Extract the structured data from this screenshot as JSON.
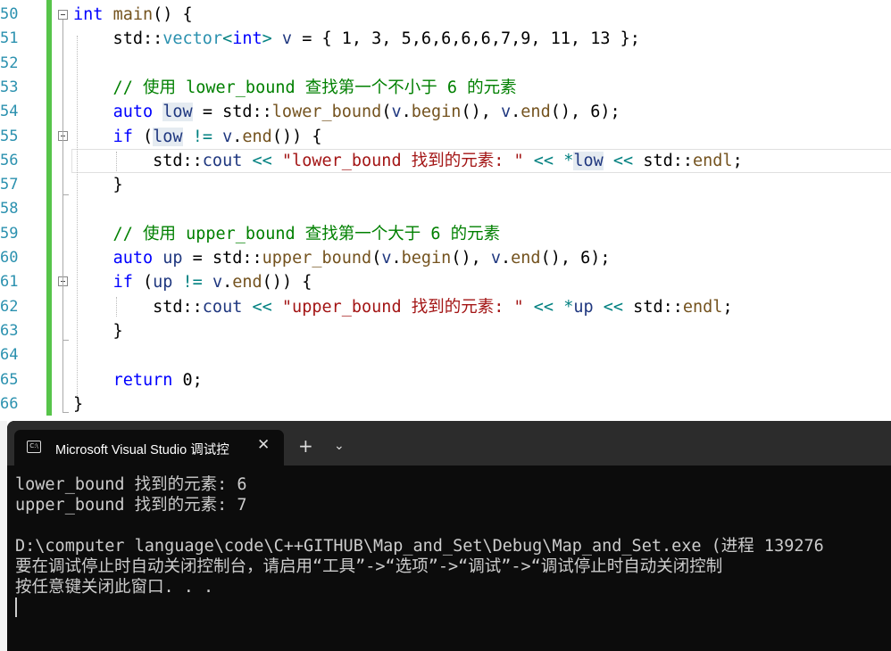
{
  "editor": {
    "line_numbers": [
      "50",
      "51",
      "52",
      "53",
      "54",
      "55",
      "56",
      "57",
      "58",
      "59",
      "60",
      "61",
      "62",
      "63",
      "64",
      "65",
      "66"
    ],
    "lines": [
      [
        {
          "c": "kw",
          "t": "int"
        },
        {
          "c": "",
          "t": " "
        },
        {
          "c": "fn",
          "t": "main"
        },
        {
          "c": "",
          "t": "() {"
        }
      ],
      [
        {
          "c": "",
          "t": "    std::"
        },
        {
          "c": "ty",
          "t": "vector"
        },
        {
          "c": "op",
          "t": "<"
        },
        {
          "c": "kw",
          "t": "int"
        },
        {
          "c": "op",
          "t": ">"
        },
        {
          "c": "",
          "t": " "
        },
        {
          "c": "vr",
          "t": "v"
        },
        {
          "c": "",
          "t": " = { 1, 3, 5,6,6,6,6,7,9, 11, 13 };"
        }
      ],
      [],
      [
        {
          "c": "cm",
          "t": "    // 使用 lower_bound 查找第一个不小于 6 的元素"
        }
      ],
      [
        {
          "c": "",
          "t": "    "
        },
        {
          "c": "kw",
          "t": "auto"
        },
        {
          "c": "",
          "t": " "
        },
        {
          "c": "vr hl",
          "t": "low"
        },
        {
          "c": "",
          "t": " = std::"
        },
        {
          "c": "fn",
          "t": "lower_bound"
        },
        {
          "c": "",
          "t": "("
        },
        {
          "c": "vr",
          "t": "v"
        },
        {
          "c": "",
          "t": "."
        },
        {
          "c": "fn",
          "t": "begin"
        },
        {
          "c": "",
          "t": "(), "
        },
        {
          "c": "vr",
          "t": "v"
        },
        {
          "c": "",
          "t": "."
        },
        {
          "c": "fn",
          "t": "end"
        },
        {
          "c": "",
          "t": "(), 6);"
        }
      ],
      [
        {
          "c": "",
          "t": "    "
        },
        {
          "c": "kw",
          "t": "if"
        },
        {
          "c": "",
          "t": " ("
        },
        {
          "c": "vr hl",
          "t": "low"
        },
        {
          "c": "",
          "t": " "
        },
        {
          "c": "op",
          "t": "!="
        },
        {
          "c": "",
          "t": " "
        },
        {
          "c": "vr",
          "t": "v"
        },
        {
          "c": "",
          "t": "."
        },
        {
          "c": "fn",
          "t": "end"
        },
        {
          "c": "",
          "t": "()) {"
        }
      ],
      [
        {
          "c": "",
          "t": "        std::"
        },
        {
          "c": "vr",
          "t": "cout"
        },
        {
          "c": "",
          "t": " "
        },
        {
          "c": "op",
          "t": "<<"
        },
        {
          "c": "",
          "t": " "
        },
        {
          "c": "st",
          "t": "\"lower_bound 找到的元素: \""
        },
        {
          "c": "",
          "t": " "
        },
        {
          "c": "op",
          "t": "<<"
        },
        {
          "c": "",
          "t": " "
        },
        {
          "c": "op",
          "t": "*"
        },
        {
          "c": "vr hl",
          "t": "low"
        },
        {
          "c": "",
          "t": " "
        },
        {
          "c": "op",
          "t": "<<"
        },
        {
          "c": "",
          "t": " std::"
        },
        {
          "c": "fn",
          "t": "endl"
        },
        {
          "c": "",
          "t": ";"
        }
      ],
      [
        {
          "c": "",
          "t": "    }"
        }
      ],
      [],
      [
        {
          "c": "cm",
          "t": "    // 使用 upper_bound 查找第一个大于 6 的元素"
        }
      ],
      [
        {
          "c": "",
          "t": "    "
        },
        {
          "c": "kw",
          "t": "auto"
        },
        {
          "c": "",
          "t": " "
        },
        {
          "c": "vr",
          "t": "up"
        },
        {
          "c": "",
          "t": " = std::"
        },
        {
          "c": "fn",
          "t": "upper_bound"
        },
        {
          "c": "",
          "t": "("
        },
        {
          "c": "vr",
          "t": "v"
        },
        {
          "c": "",
          "t": "."
        },
        {
          "c": "fn",
          "t": "begin"
        },
        {
          "c": "",
          "t": "(), "
        },
        {
          "c": "vr",
          "t": "v"
        },
        {
          "c": "",
          "t": "."
        },
        {
          "c": "fn",
          "t": "end"
        },
        {
          "c": "",
          "t": "(), 6);"
        }
      ],
      [
        {
          "c": "",
          "t": "    "
        },
        {
          "c": "kw",
          "t": "if"
        },
        {
          "c": "",
          "t": " ("
        },
        {
          "c": "vr",
          "t": "up"
        },
        {
          "c": "",
          "t": " "
        },
        {
          "c": "op",
          "t": "!="
        },
        {
          "c": "",
          "t": " "
        },
        {
          "c": "vr",
          "t": "v"
        },
        {
          "c": "",
          "t": "."
        },
        {
          "c": "fn",
          "t": "end"
        },
        {
          "c": "",
          "t": "()) {"
        }
      ],
      [
        {
          "c": "",
          "t": "        std::"
        },
        {
          "c": "vr",
          "t": "cout"
        },
        {
          "c": "",
          "t": " "
        },
        {
          "c": "op",
          "t": "<<"
        },
        {
          "c": "",
          "t": " "
        },
        {
          "c": "st",
          "t": "\"upper_bound 找到的元素: \""
        },
        {
          "c": "",
          "t": " "
        },
        {
          "c": "op",
          "t": "<<"
        },
        {
          "c": "",
          "t": " "
        },
        {
          "c": "op",
          "t": "*"
        },
        {
          "c": "vr",
          "t": "up"
        },
        {
          "c": "",
          "t": " "
        },
        {
          "c": "op",
          "t": "<<"
        },
        {
          "c": "",
          "t": " std::"
        },
        {
          "c": "fn",
          "t": "endl"
        },
        {
          "c": "",
          "t": ";"
        }
      ],
      [
        {
          "c": "",
          "t": "    }"
        }
      ],
      [],
      [
        {
          "c": "",
          "t": "    "
        },
        {
          "c": "kw",
          "t": "return"
        },
        {
          "c": "",
          "t": " 0;"
        }
      ],
      [
        {
          "c": "",
          "t": "}"
        }
      ]
    ]
  },
  "terminal": {
    "tab_title": "Microsoft Visual Studio 调试控",
    "new_tab_symbol": "+",
    "dropdown_symbol": "⌄",
    "close_symbol": "✕",
    "icon_text": "C:\\",
    "output": [
      "lower_bound 找到的元素: 6",
      "upper_bound 找到的元素: 7",
      "",
      "D:\\computer language\\code\\C++GITHUB\\Map_and_Set\\Debug\\Map_and_Set.exe (进程 139276",
      "要在调试停止时自动关闭控制台，请启用“工具”->“选项”->“调试”->“调试停止时自动关闭控制",
      "按任意键关闭此窗口. . ."
    ]
  }
}
